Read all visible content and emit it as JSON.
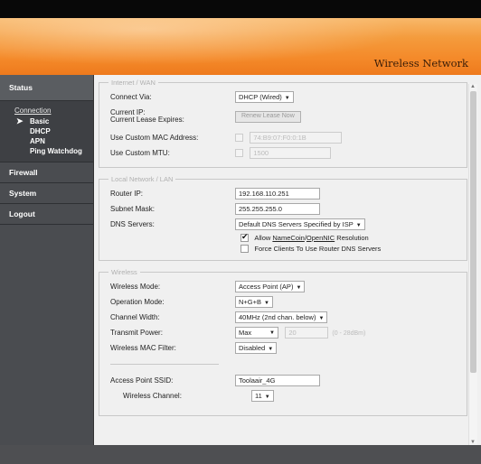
{
  "header": {
    "title": "Wireless Network"
  },
  "sidebar": {
    "status": "Status",
    "section": "Connection",
    "items": [
      "Basic",
      "DHCP",
      "APN",
      "Ping Watchdog"
    ],
    "firewall": "Firewall",
    "system": "System",
    "logout": "Logout"
  },
  "wan": {
    "legend": "Internet / WAN",
    "connect_via_label": "Connect Via:",
    "connect_via_value": "DHCP (Wired)",
    "current_ip_label": "Current IP:",
    "lease_label": "Current Lease Expires:",
    "renew_button": "Renew Lease Now",
    "mac_label": "Use Custom MAC Address:",
    "mac_value": "74:B9:07:F0:0:1B",
    "mtu_label": "Use Custom MTU:",
    "mtu_value": "1500"
  },
  "lan": {
    "legend": "Local Network / LAN",
    "router_ip_label": "Router IP:",
    "router_ip_value": "192.168.110.251",
    "subnet_label": "Subnet Mask:",
    "subnet_value": "255.255.255.0",
    "dns_label": "DNS Servers:",
    "dns_value": "Default DNS Servers Specified by ISP",
    "allow_namecoin_pre": "Allow ",
    "allow_namecoin_link1": "NameCoin",
    "allow_namecoin_sep": "/",
    "allow_namecoin_link2": "OpenNIC",
    "allow_namecoin_post": " Resolution",
    "force_dns_label": "Force Clients To Use Router DNS Servers"
  },
  "wireless": {
    "legend": "Wireless",
    "mode_label": "Wireless Mode:",
    "mode_value": "Access Point (AP)",
    "op_mode_label": "Operation Mode:",
    "op_mode_value": "N+G+B",
    "width_label": "Channel Width:",
    "width_value": "40MHz (2nd chan. below)",
    "power_label": "Transmit Power:",
    "power_value": "Max",
    "power_input": "20",
    "power_range": "(0 - 28dBm)",
    "mac_filter_label": "Wireless MAC Filter:",
    "mac_filter_value": "Disabled",
    "ssid_label": "Access Point SSID:",
    "ssid_value": "Toolaair_4G",
    "channel_label": "Wireless Channel:",
    "channel_value": "11"
  }
}
